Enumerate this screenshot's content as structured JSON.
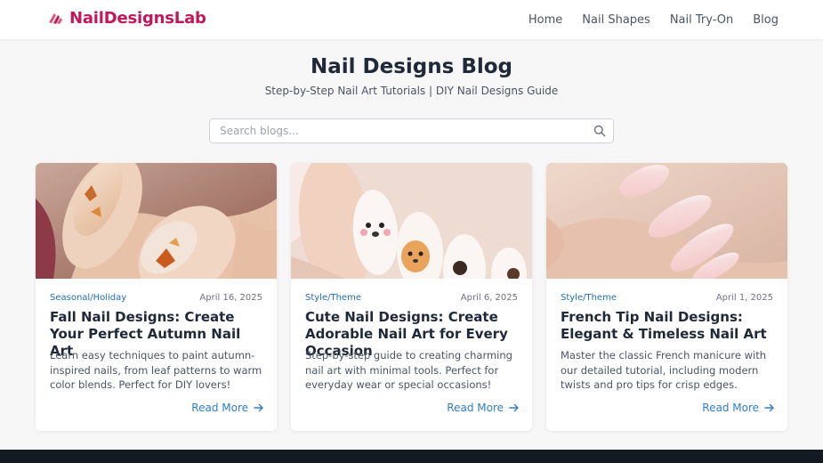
{
  "header": {
    "logo_text": "NailDesignsLab",
    "nav": [
      "Home",
      "Nail Shapes",
      "Nail Try-On",
      "Blog"
    ]
  },
  "hero": {
    "title": "Nail Designs Blog",
    "subtitle": "Step-by-Step Nail Art Tutorials | DIY Nail Designs Guide"
  },
  "search": {
    "placeholder": "Search blogs..."
  },
  "cards": [
    {
      "category": "Seasonal/Holiday",
      "date": "April 16, 2025",
      "title": "Fall Nail Designs: Create Your Perfect Autumn Nail Art",
      "excerpt": "Learn easy techniques to paint autumn-inspired nails, from leaf patterns to warm color blends. Perfect for DIY lovers!",
      "read_more": "Read More"
    },
    {
      "category": "Style/Theme",
      "date": "April 6, 2025",
      "title": "Cute Nail Designs: Create Adorable Nail Art for Every Occasion",
      "excerpt": "Step-by-step guide to creating charming nail art with minimal tools. Perfect for everyday wear or special occasions!",
      "read_more": "Read More"
    },
    {
      "category": "Style/Theme",
      "date": "April 1, 2025",
      "title": "French Tip Nail Designs: Elegant & Timeless Nail Art",
      "excerpt": "Master the classic French manicure with our detailed tutorial, including modern twists and pro tips for crisp edges.",
      "read_more": "Read More"
    }
  ],
  "colors": {
    "brand": "#c2185b",
    "link": "#2f7ec7",
    "category": "#1d6fb8",
    "footer": "#141a22"
  },
  "icons": {
    "logo": "nail-polish-logo-icon",
    "search": "search-icon",
    "read_more": "arrow-right-icon"
  }
}
